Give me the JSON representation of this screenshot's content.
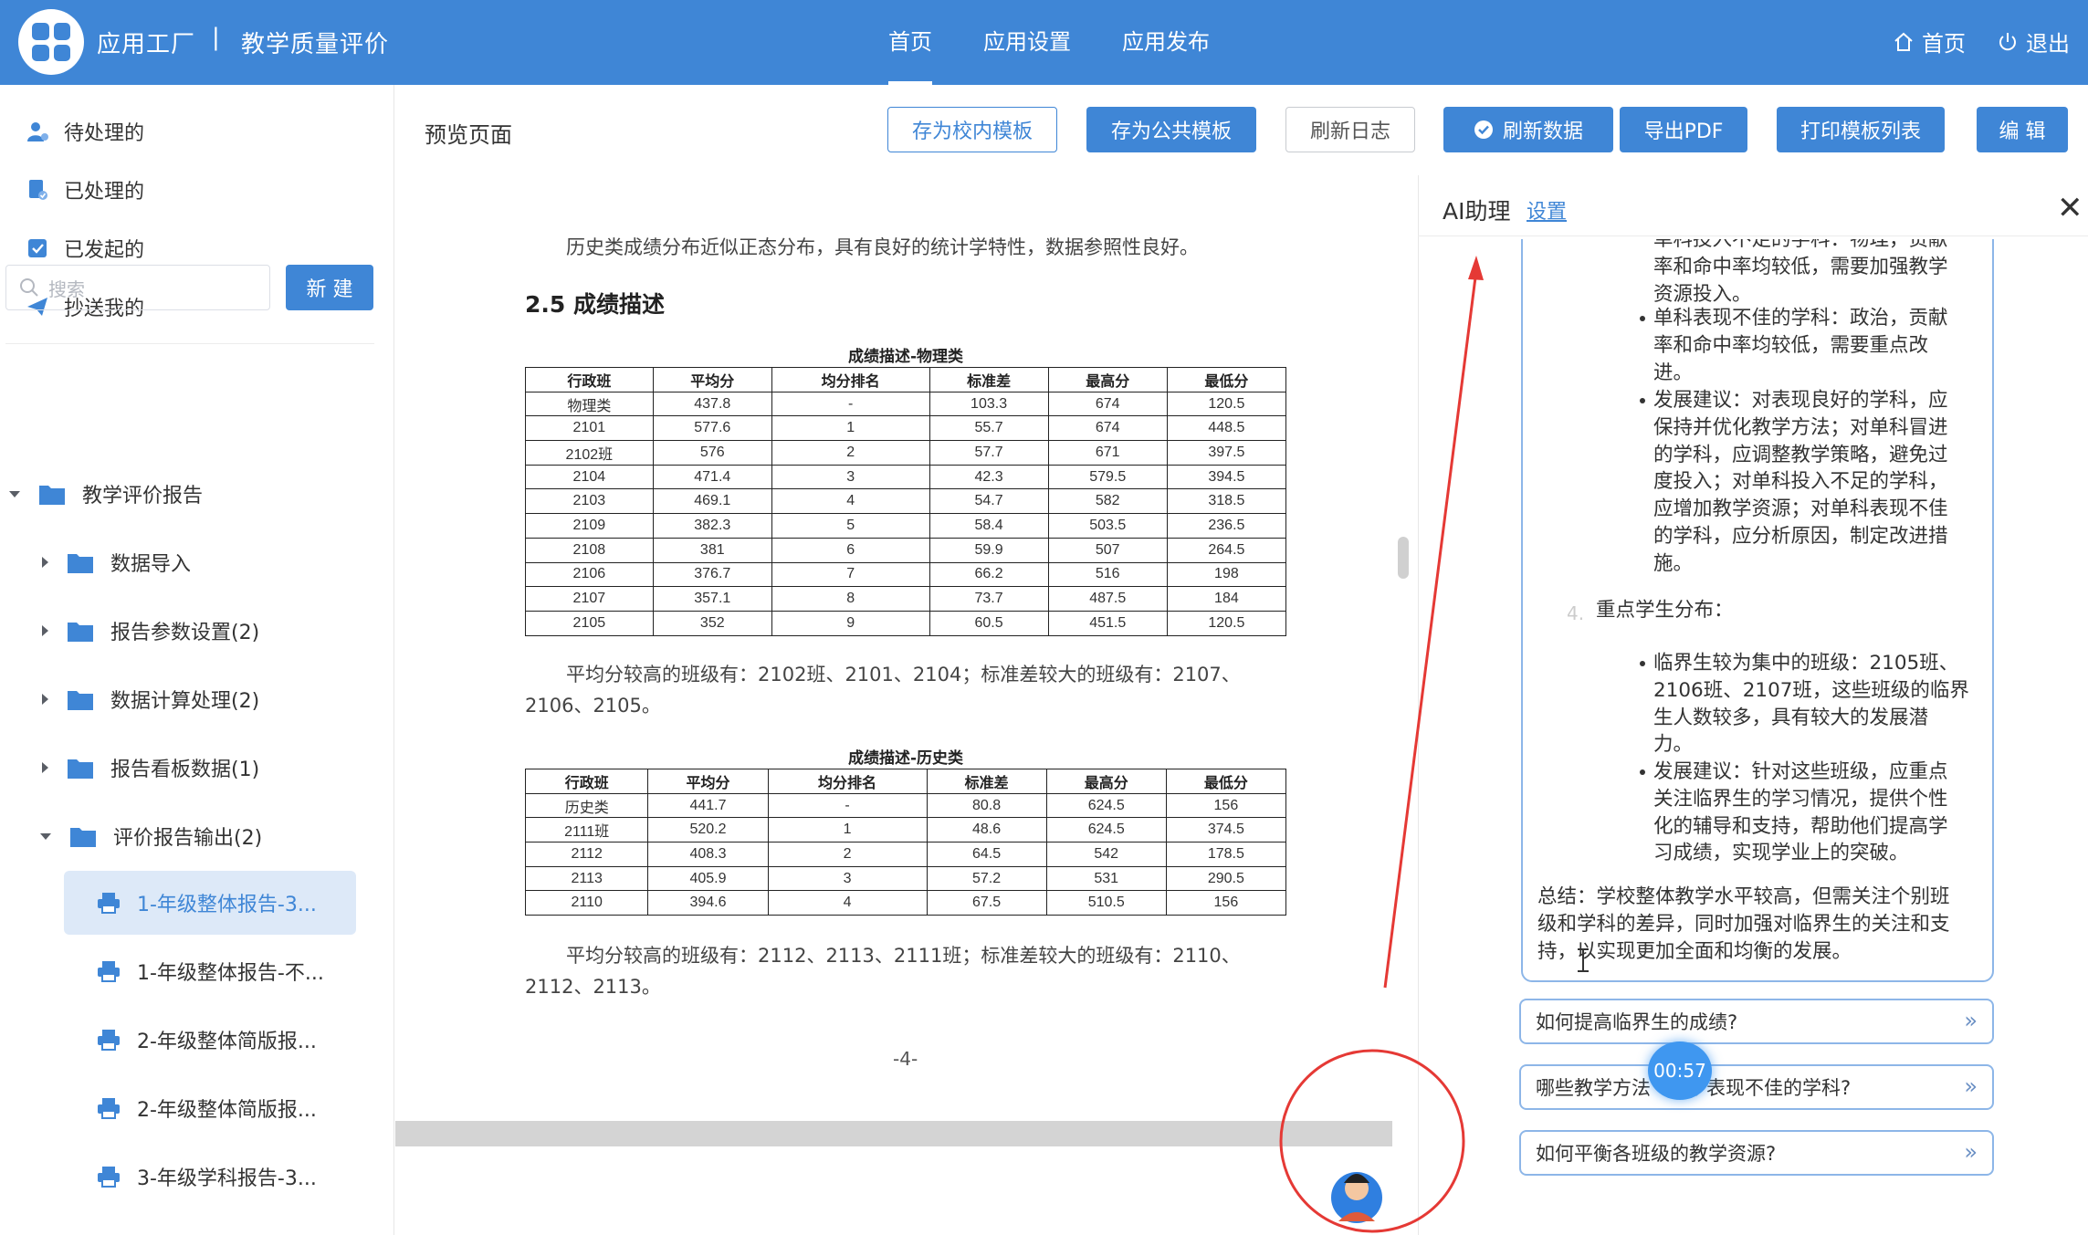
{
  "header": {
    "brand": "应用工厂",
    "separator": "|",
    "subtitle": "教学质量评价",
    "nav": [
      "首页",
      "应用设置",
      "应用发布"
    ],
    "home_label": "首页",
    "logout_label": "退出"
  },
  "sidebar": {
    "links": [
      "待处理的",
      "已处理的",
      "已发起的",
      "抄送我的"
    ],
    "search_placeholder": "搜索",
    "new_button": "新 建",
    "tree_root": "教学评价报告",
    "tree_children": [
      "数据导入",
      "报告参数设置(2)",
      "数据计算处理(2)",
      "报告看板数据(1)",
      "评价报告输出(2)"
    ],
    "reports": [
      "1-年级整体报告-3...",
      "1-年级整体报告-不...",
      "2-年级整体简版报...",
      "2-年级整体简版报...",
      "3-年级学科报告-3..."
    ]
  },
  "toolbar": {
    "title": "预览页面",
    "save_school": "存为校内模板",
    "save_public": "存为公共模板",
    "refresh_log": "刷新日志",
    "refresh_data": "刷新数据",
    "export_pdf": "导出PDF",
    "print_list": "打印模板列表",
    "edit": "编 辑"
  },
  "document": {
    "intro": "历史类成绩分布近似正态分布，具有良好的统计学特性，数据参照性良好。",
    "heading": "2.5 成绩描述",
    "columns": [
      "行政班",
      "平均分",
      "均分排名",
      "标准差",
      "最高分",
      "最低分"
    ],
    "table1_title": "成绩描述-物理类",
    "table1": [
      [
        "物理类",
        "437.8",
        "-",
        "103.3",
        "674",
        "120.5"
      ],
      [
        "2101",
        "577.6",
        "1",
        "55.7",
        "674",
        "448.5"
      ],
      [
        "2102班",
        "576",
        "2",
        "57.7",
        "671",
        "397.5"
      ],
      [
        "2104",
        "471.4",
        "3",
        "42.3",
        "579.5",
        "394.5"
      ],
      [
        "2103",
        "469.1",
        "4",
        "54.7",
        "582",
        "318.5"
      ],
      [
        "2109",
        "382.3",
        "5",
        "58.4",
        "503.5",
        "236.5"
      ],
      [
        "2108",
        "381",
        "6",
        "59.9",
        "507",
        "264.5"
      ],
      [
        "2106",
        "376.7",
        "7",
        "66.2",
        "516",
        "198"
      ],
      [
        "2107",
        "357.1",
        "8",
        "73.7",
        "487.5",
        "184"
      ],
      [
        "2105",
        "352",
        "9",
        "60.5",
        "451.5",
        "120.5"
      ]
    ],
    "table1_summary_line1": "平均分较高的班级有：2102班、2101、2104；标准差较大的班级有：2107、",
    "table1_summary_line2": "2106、2105。",
    "table2_title": "成绩描述-历史类",
    "table2": [
      [
        "历史类",
        "441.7",
        "-",
        "80.8",
        "624.5",
        "156"
      ],
      [
        "2111班",
        "520.2",
        "1",
        "48.6",
        "624.5",
        "374.5"
      ],
      [
        "2112",
        "408.3",
        "2",
        "64.5",
        "542",
        "178.5"
      ],
      [
        "2113",
        "405.9",
        "3",
        "57.2",
        "531",
        "290.5"
      ],
      [
        "2110",
        "394.6",
        "4",
        "67.5",
        "510.5",
        "156"
      ]
    ],
    "table2_summary_line1": "平均分较高的班级有：2112、2113、2111班；标准差较大的班级有：2110、",
    "table2_summary_line2": "2112、2113。",
    "page_number": "-4-"
  },
  "ai": {
    "title": "AI助理",
    "settings": "设置",
    "close": "✕",
    "lines_a": [
      "单科投入不足的学科：物理，贡献",
      "率和命中率均较低，需要加强教学",
      "资源投入。"
    ],
    "lines_b": [
      "单科表现不佳的学科：政治，贡献",
      "率和命中率均较低，需要重点改",
      "进。"
    ],
    "lines_c": [
      "发展建议：对表现良好的学科，应",
      "保持并优化教学方法；对单科冒进",
      "的学科，应调整教学策略，避免过",
      "度投入；对单科投入不足的学科，",
      "应增加教学资源；对单科表现不佳",
      "的学科，应分析原因，制定改进措",
      "施。"
    ],
    "sub_number": "4.",
    "sub_heading": "重点学生分布：",
    "lines_d": [
      "临界生较为集中的班级：2105班、",
      "2106班、2107班，这些班级的临界",
      "生人数较多，具有较大的发展潜",
      "力。"
    ],
    "lines_e": [
      "发展建议：针对这些班级，应重点",
      "关注临界生的学习情况，提供个性",
      "化的辅导和支持，帮助他们提高学",
      "习成绩，实现学业上的突破。"
    ],
    "summary": [
      "总结：学校整体教学水平较高，但需关注个别班",
      "级和学科的差异，同时加强对临界生的关注和支",
      "持，以实现更加全面和均衡的发展。"
    ],
    "suggestions": [
      "如何提高临界生的成绩?",
      "哪些教学方法      于表现不佳的学科?",
      "如何平衡各班级的教学资源?"
    ],
    "timer": "00:57"
  }
}
